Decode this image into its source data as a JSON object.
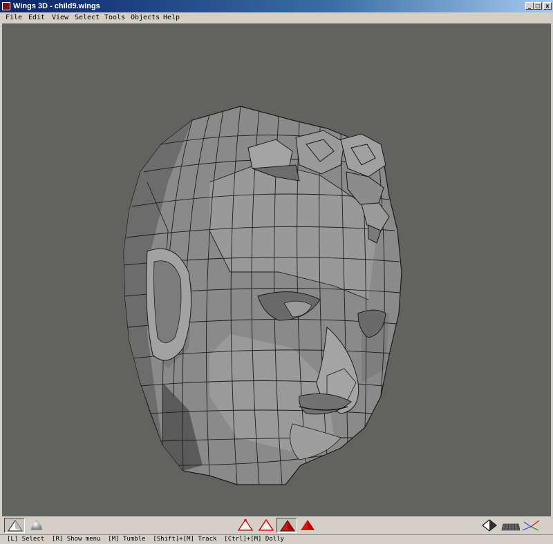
{
  "window": {
    "title": "Wings 3D - child9.wings",
    "controls": {
      "minimize": "_",
      "maximize": "□",
      "close": "x"
    }
  },
  "menu": [
    "File",
    "Edit",
    "View",
    "Select",
    "Tools",
    "Objects",
    "Help"
  ],
  "toolbar": {
    "left": [
      {
        "icon": "flat-shading-icon",
        "pressed": true
      },
      {
        "icon": "smooth-shading-icon",
        "pressed": false
      }
    ],
    "selection_modes": [
      {
        "icon": "vertex-select-mode-icon",
        "pressed": false
      },
      {
        "icon": "edge-select-mode-icon",
        "pressed": false
      },
      {
        "icon": "face-select-mode-icon",
        "pressed": true
      },
      {
        "icon": "body-select-mode-icon",
        "pressed": false
      }
    ],
    "right": [
      {
        "icon": "wireframe-toggle-icon"
      },
      {
        "icon": "ground-grid-icon"
      },
      {
        "icon": "axes-icon"
      }
    ]
  },
  "status": {
    "text": "[L] Select  [R] Show menu  [M] Tumble  [Shift]+[M] Track  [Ctrl]+[M] Dolly"
  },
  "colors": {
    "viewport_bg": "#62625e",
    "mesh_face": "#8c8c8c",
    "mesh_edge": "#1c1c1c",
    "select_red": "#e01010",
    "title_bar": "#0a246a"
  },
  "viewport": {
    "model_icon": "polygon-head-model"
  }
}
